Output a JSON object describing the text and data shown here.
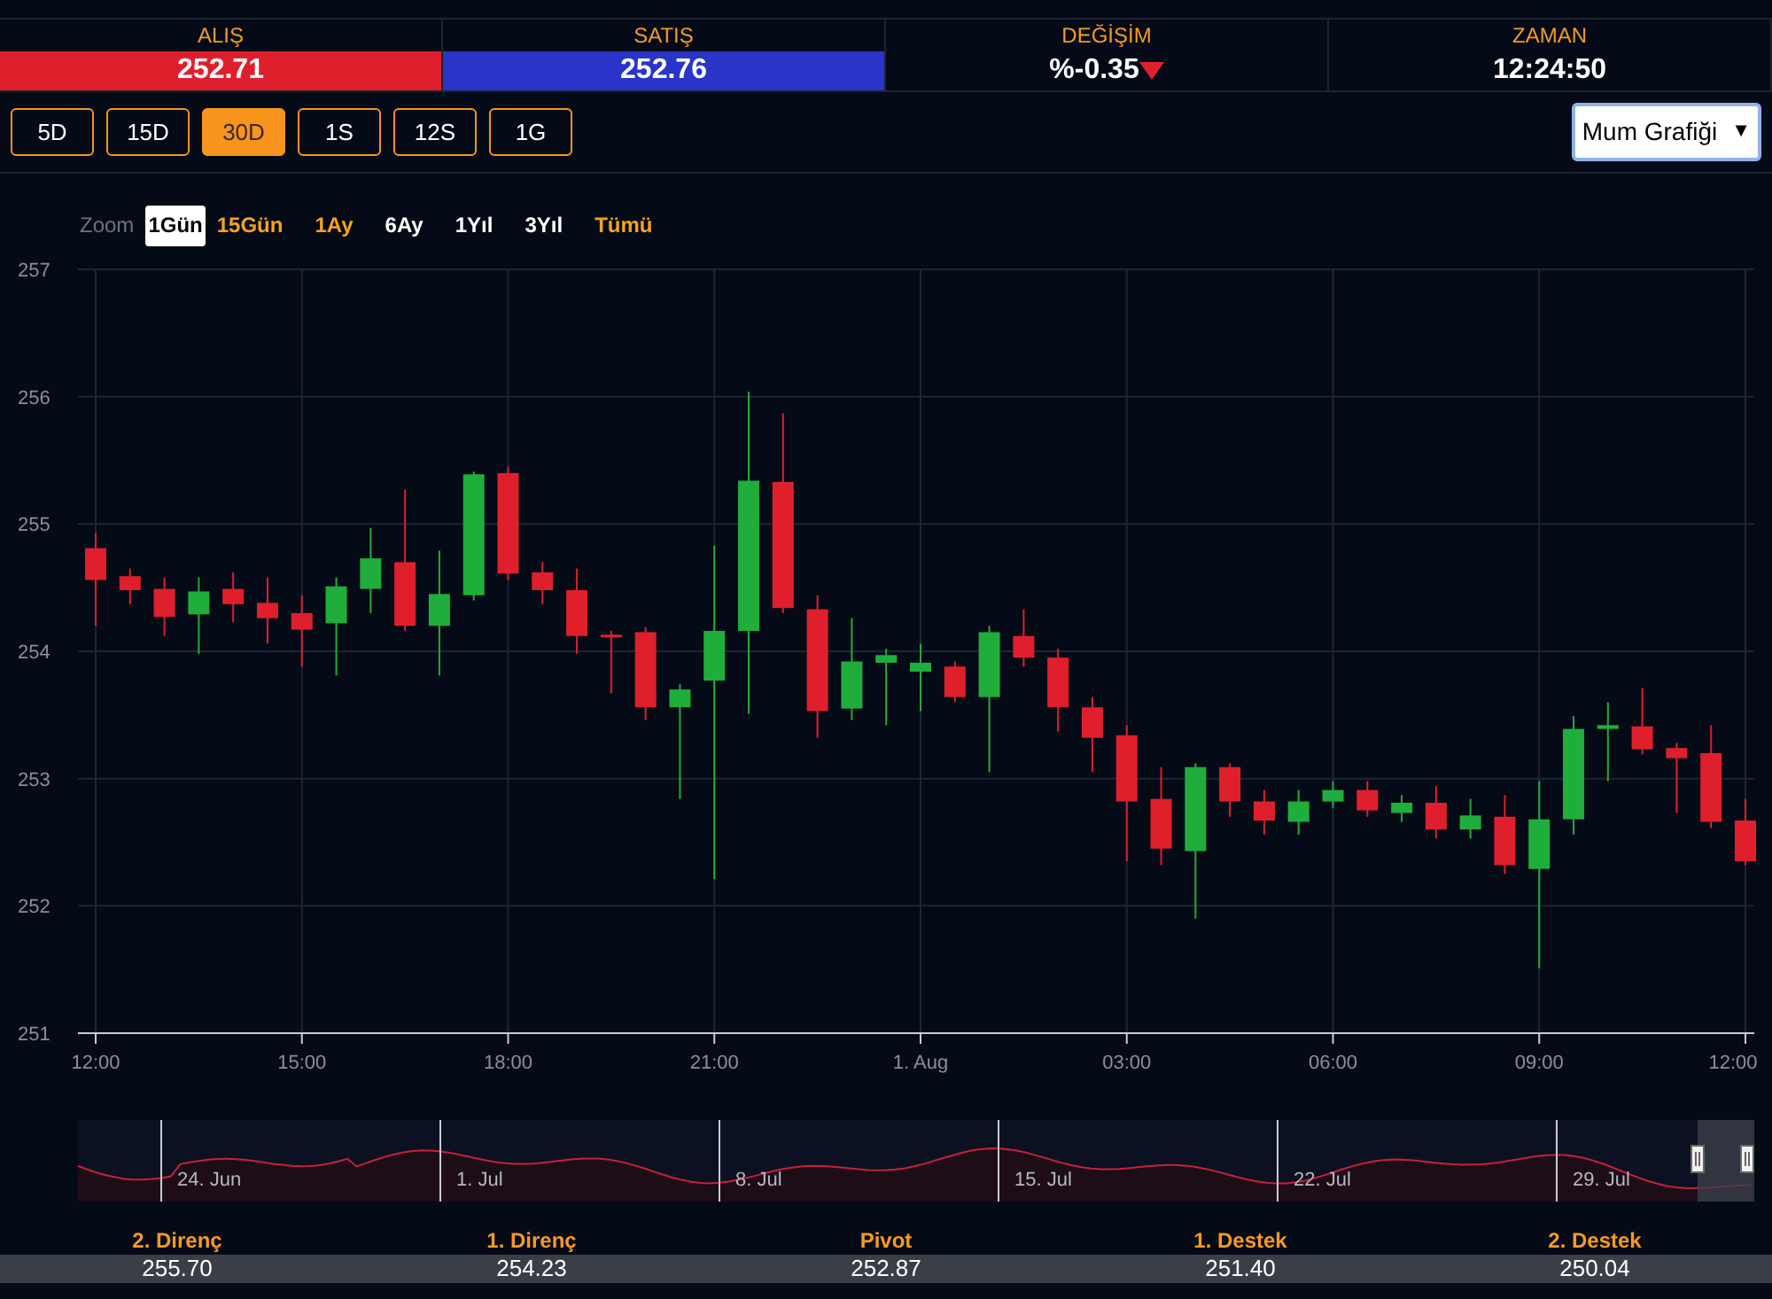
{
  "quote": [
    {
      "label": "ALIŞ",
      "value": "252.71",
      "kind": "bid"
    },
    {
      "label": "SATIŞ",
      "value": "252.76",
      "kind": "ask"
    },
    {
      "label": "DEĞİŞİM",
      "value": "%-0.35",
      "kind": "change",
      "falling": true
    },
    {
      "label": "ZAMAN",
      "value": "12:24:50",
      "kind": "time"
    }
  ],
  "periods": [
    {
      "label": "5D",
      "selected": false
    },
    {
      "label": "15D",
      "selected": false
    },
    {
      "label": "30D",
      "selected": true
    },
    {
      "label": "1S",
      "selected": false
    },
    {
      "label": "12S",
      "selected": false
    },
    {
      "label": "1G",
      "selected": false
    }
  ],
  "chart_type_select": {
    "value": "Mum Grafiği",
    "caret": "▼"
  },
  "zoom": {
    "label": "Zoom",
    "options": [
      {
        "label": "1Gün",
        "selected": true,
        "color": "#000000"
      },
      {
        "label": "15Gün",
        "selected": false,
        "color": "#f7a21b"
      },
      {
        "label": "1Ay",
        "selected": false,
        "color": "#f7a21b"
      },
      {
        "label": "6Ay",
        "selected": false,
        "color": "#ffffff"
      },
      {
        "label": "1Yıl",
        "selected": false,
        "color": "#ffffff"
      },
      {
        "label": "3Yıl",
        "selected": false,
        "color": "#ffffff"
      },
      {
        "label": "Tümü",
        "selected": false,
        "color": "#f7a21b"
      }
    ]
  },
  "chart_data": {
    "type": "candlestick",
    "grid": true,
    "ylim": [
      251,
      257
    ],
    "yticks": [
      251,
      252,
      253,
      254,
      255,
      256,
      257
    ],
    "categories": [
      "12:00",
      null,
      null,
      null,
      null,
      null,
      "15:00",
      null,
      null,
      null,
      null,
      null,
      "18:00",
      null,
      null,
      null,
      null,
      null,
      "21:00",
      null,
      null,
      null,
      null,
      null,
      "1. Aug",
      null,
      null,
      null,
      null,
      null,
      "03:00",
      null,
      null,
      null,
      null,
      null,
      "06:00",
      null,
      null,
      null,
      null,
      null,
      "09:00",
      null,
      null,
      null,
      null,
      null,
      "12:00"
    ],
    "ohlc": [
      [
        254.81,
        254.93,
        254.2,
        254.56
      ],
      [
        254.59,
        254.65,
        254.37,
        254.48
      ],
      [
        254.49,
        254.58,
        254.12,
        254.27
      ],
      [
        254.29,
        254.58,
        253.98,
        254.47
      ],
      [
        254.49,
        254.62,
        254.23,
        254.37
      ],
      [
        254.38,
        254.58,
        254.06,
        254.26
      ],
      [
        254.3,
        254.44,
        253.88,
        254.17
      ],
      [
        254.22,
        254.58,
        253.81,
        254.51
      ],
      [
        254.49,
        254.97,
        254.3,
        254.73
      ],
      [
        254.7,
        255.27,
        254.16,
        254.2
      ],
      [
        254.2,
        254.79,
        253.81,
        254.45
      ],
      [
        254.44,
        255.41,
        254.4,
        255.39
      ],
      [
        255.4,
        255.45,
        254.56,
        254.61
      ],
      [
        254.62,
        254.7,
        254.37,
        254.48
      ],
      [
        254.48,
        254.65,
        253.98,
        254.12
      ],
      [
        254.13,
        254.16,
        253.67,
        254.12
      ],
      [
        254.15,
        254.19,
        253.46,
        253.56
      ],
      [
        253.56,
        253.74,
        252.84,
        253.7
      ],
      [
        253.77,
        254.83,
        252.21,
        254.16
      ],
      [
        254.16,
        256.04,
        253.51,
        255.34
      ],
      [
        255.33,
        255.87,
        254.3,
        254.34
      ],
      [
        254.33,
        254.44,
        253.32,
        253.53
      ],
      [
        253.55,
        254.26,
        253.46,
        253.92
      ],
      [
        253.91,
        254.02,
        253.42,
        253.97
      ],
      [
        253.84,
        254.06,
        253.53,
        253.91
      ],
      [
        253.88,
        253.92,
        253.6,
        253.64
      ],
      [
        253.64,
        254.2,
        253.05,
        254.15
      ],
      [
        254.12,
        254.33,
        253.88,
        253.95
      ],
      [
        253.95,
        254.02,
        253.37,
        253.56
      ],
      [
        253.56,
        253.64,
        253.05,
        253.32
      ],
      [
        253.34,
        253.42,
        252.35,
        252.82
      ],
      [
        252.84,
        253.09,
        252.32,
        252.45
      ],
      [
        252.43,
        253.12,
        251.9,
        253.09
      ],
      [
        253.09,
        253.12,
        252.7,
        252.82
      ],
      [
        252.82,
        252.91,
        252.56,
        252.67
      ],
      [
        252.66,
        252.91,
        252.56,
        252.82
      ],
      [
        252.82,
        252.98,
        252.77,
        252.91
      ],
      [
        252.91,
        252.98,
        252.7,
        252.75
      ],
      [
        252.73,
        252.87,
        252.66,
        252.81
      ],
      [
        252.81,
        252.94,
        252.53,
        252.6
      ],
      [
        252.6,
        252.84,
        252.53,
        252.71
      ],
      [
        252.7,
        252.87,
        252.25,
        252.32
      ],
      [
        252.29,
        252.98,
        251.51,
        252.68
      ],
      [
        252.68,
        253.49,
        252.56,
        253.39
      ],
      [
        253.39,
        253.6,
        252.98,
        253.42
      ],
      [
        253.41,
        253.71,
        253.19,
        253.23
      ],
      [
        253.24,
        253.28,
        252.73,
        253.16
      ],
      [
        253.2,
        253.42,
        252.61,
        252.66
      ],
      [
        252.67,
        252.84,
        252.32,
        252.35
      ]
    ]
  },
  "navigator": {
    "dates": [
      "24. Jun",
      "1. Jul",
      "8. Jul",
      "15. Jul",
      "22. Jul",
      "29. Jul"
    ]
  },
  "levels": [
    {
      "label": "2. Direnç",
      "value": "255.70"
    },
    {
      "label": "1. Direnç",
      "value": "254.23"
    },
    {
      "label": "Pivot",
      "value": "252.87"
    },
    {
      "label": "1. Destek",
      "value": "251.40"
    },
    {
      "label": "2. Destek",
      "value": "250.04"
    }
  ]
}
